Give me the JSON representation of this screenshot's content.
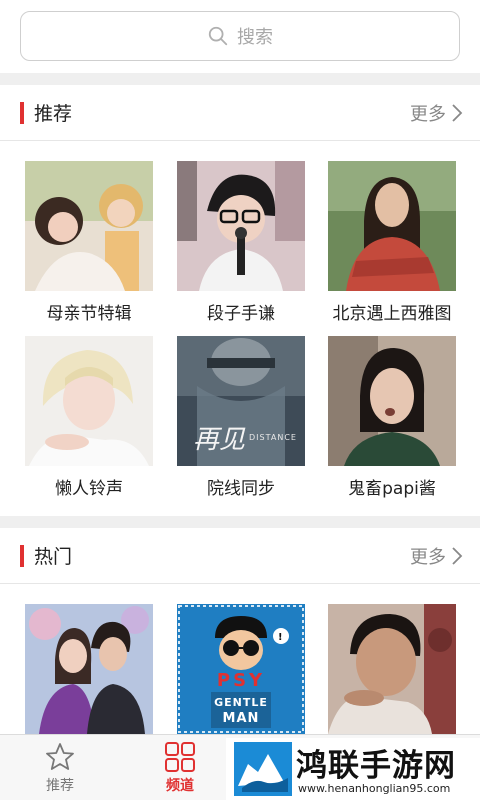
{
  "search": {
    "placeholder": "搜索"
  },
  "sections": [
    {
      "title": "推荐",
      "more": "更多",
      "items": [
        {
          "caption": "母亲节特辑"
        },
        {
          "caption": "段子手谦"
        },
        {
          "caption": "北京遇上西雅图"
        },
        {
          "caption": "懒人铃声"
        },
        {
          "caption": "院线同步"
        },
        {
          "caption": "鬼畜papi酱"
        }
      ]
    },
    {
      "title": "热门",
      "more": "更多",
      "items": [
        {
          "caption": ""
        },
        {
          "caption": ""
        },
        {
          "caption": ""
        }
      ]
    }
  ],
  "album_art_text": {
    "psy": "PSY",
    "gentleman_1": "GENTLE",
    "gentleman_2": "MAN",
    "distance": "DISTANCE",
    "zaijian": "再见"
  },
  "nav": [
    {
      "label": "推荐",
      "icon": "star-icon",
      "active": false
    },
    {
      "label": "频道",
      "icon": "grid-icon",
      "active": true
    }
  ],
  "watermark": {
    "title": "鸿联手游网",
    "url": "www.henanhonglian95.com"
  },
  "colors": {
    "accent": "#e03131",
    "nav_active": "#e03131",
    "nav_inactive": "#777777"
  }
}
